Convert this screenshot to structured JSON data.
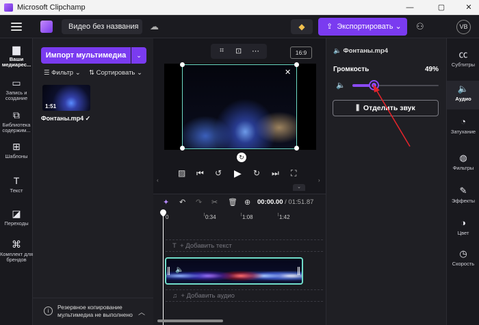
{
  "window": {
    "title": "Microsoft Clipchamp",
    "minimize_glyph": "—",
    "maximize_glyph": "▢",
    "close_glyph": "✕"
  },
  "header": {
    "project_name": "Видео без названия",
    "export_label": "Экспортировать",
    "avatar_initials": "VB",
    "cloud_icon": "cloud-off-icon",
    "premium_icon": "diamond-icon",
    "share_icon": "people-icon"
  },
  "leftnav": {
    "items": [
      {
        "icon": "folder-icon",
        "glyph": "▆",
        "label": "Ваши медиарес..."
      },
      {
        "icon": "camera-icon",
        "glyph": "▭",
        "label": "Запись и создание"
      },
      {
        "icon": "library-icon",
        "glyph": "⧉",
        "label": "Библиотека содержим..."
      },
      {
        "icon": "templates-icon",
        "glyph": "⊞",
        "label": "Шаблоны"
      },
      {
        "icon": "text-icon",
        "glyph": "T",
        "label": "Текст"
      },
      {
        "icon": "transitions-icon",
        "glyph": "◪",
        "label": "Переходы"
      },
      {
        "icon": "brand-kit-icon",
        "glyph": "⌘",
        "label": "Комплект для брендов"
      }
    ]
  },
  "media": {
    "import_label": "Импорт мультимедиа",
    "filter_label": "Фильтр",
    "sort_label": "Сортировать",
    "thumb_duration": "1:51",
    "file_name": "Фонтаны.mp4",
    "backup_text": "Резервное копирование мультимедиа не выполнено"
  },
  "preview": {
    "aspect_ratio": "16:9"
  },
  "timeline": {
    "current_time": "00:00.00",
    "total_time": "/ 01:51.87",
    "ticks": [
      "0",
      "0:34",
      "1:08",
      "1:42"
    ],
    "add_text_label": "+ Добавить текст",
    "add_audio_label": "+ Добавить аудио"
  },
  "properties": {
    "file_title": "Фонтаны.mp4",
    "volume_label": "Громкость",
    "volume_percent": "49%",
    "volume_value": 0.49,
    "detach_label": "Отделить звук",
    "accent_color": "#7a3bf0"
  },
  "tabs": {
    "items": [
      {
        "icon": "captions-icon",
        "glyph": "㏄",
        "label": "Субтитры"
      },
      {
        "icon": "audio-icon",
        "glyph": "🔈",
        "label": "Аудио"
      },
      {
        "icon": "fade-icon",
        "glyph": "◔",
        "label": "Затухание"
      },
      {
        "icon": "filters-icon",
        "glyph": "◍",
        "label": "Фильтры"
      },
      {
        "icon": "effects-icon",
        "glyph": "✎",
        "label": "Эффекты"
      },
      {
        "icon": "color-icon",
        "glyph": "◑",
        "label": "Цвет"
      },
      {
        "icon": "speed-icon",
        "glyph": "◷",
        "label": "Скорость"
      }
    ]
  }
}
